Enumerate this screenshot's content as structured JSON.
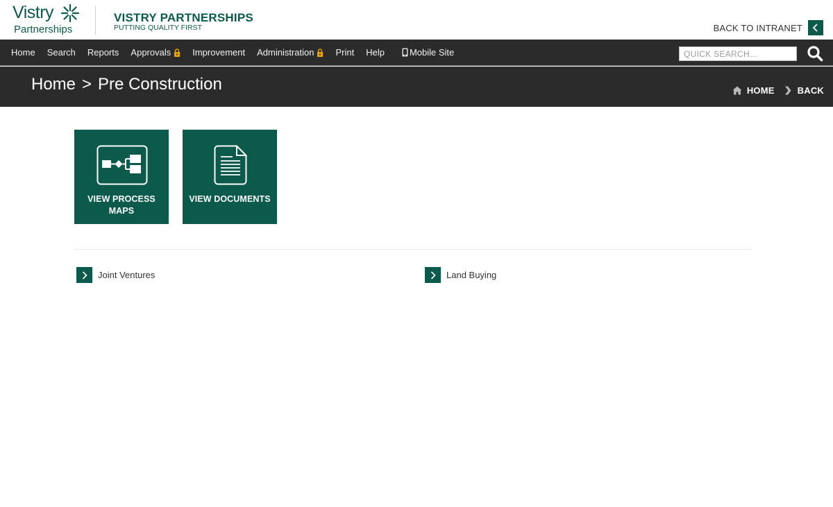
{
  "header": {
    "logo_word": "Vistry",
    "logo_sub": "Partnerships",
    "brand_title": "VISTRY PARTNERSHIPS",
    "brand_tagline": "PUTTING QUALITY FIRST",
    "back_to_intranet": "BACK TO INTRANET",
    "brand_color": "#0b5a4c"
  },
  "nav": {
    "items": [
      {
        "label": "Home"
      },
      {
        "label": "Search"
      },
      {
        "label": "Reports"
      },
      {
        "label": "Approvals",
        "icon": "lock-icon"
      },
      {
        "label": "Improvement"
      },
      {
        "label": "Administration",
        "icon": "lock-icon"
      },
      {
        "label": "Print"
      },
      {
        "label": "Help"
      },
      {
        "label": "Mobile Site",
        "icon": "mobile-icon"
      }
    ],
    "search_placeholder": "QUICK SEARCH...",
    "bar_color": "#2b2b2b",
    "lock_color": "#e8a400"
  },
  "title_band": {
    "crumb_home": "Home",
    "crumb_separator": ">",
    "crumb_current": "Pre Construction",
    "home_link": "HOME",
    "back_link": "BACK"
  },
  "tiles": [
    {
      "label": "VIEW PROCESS MAPS",
      "icon": "process-map-icon"
    },
    {
      "label": "VIEW DOCUMENTS",
      "icon": "document-icon"
    }
  ],
  "links": [
    {
      "label": "Joint Ventures"
    },
    {
      "label": "Land Buying"
    }
  ]
}
